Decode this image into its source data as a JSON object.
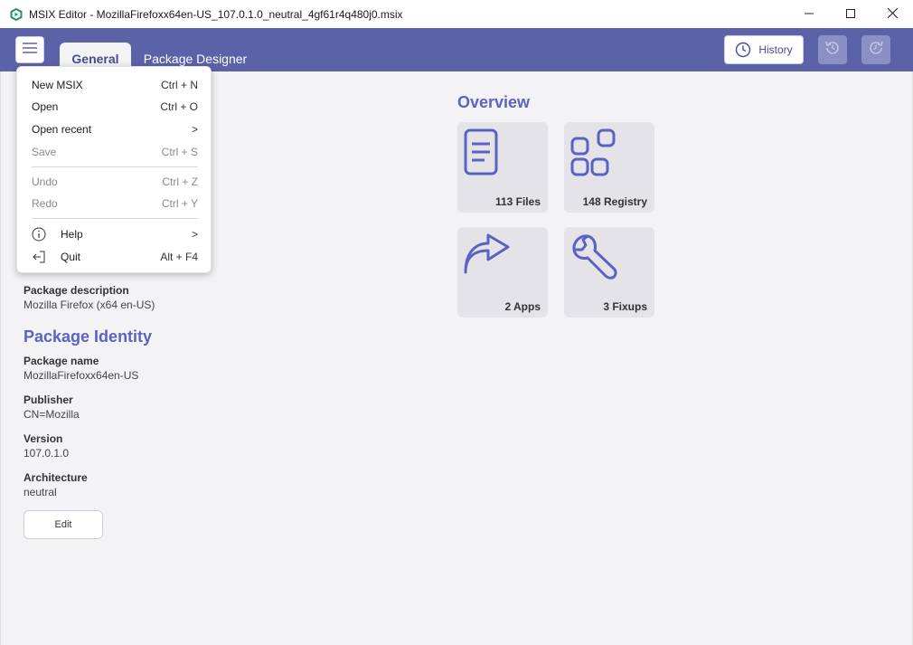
{
  "window": {
    "title": "MSIX Editor - MozillaFirefoxx64en-US_107.0.1.0_neutral_4gf61r4q480j0.msix",
    "controls": [
      "minimize-icon",
      "maximize-icon",
      "close-icon"
    ]
  },
  "header": {
    "tabs": [
      {
        "label": "General",
        "active": true
      },
      {
        "label": "Package Designer",
        "active": false
      }
    ],
    "history_label": "History"
  },
  "menu": {
    "items": [
      {
        "label": "New MSIX",
        "shortcut": "Ctrl + N",
        "enabled": true
      },
      {
        "label": "Open",
        "shortcut": "Ctrl + O",
        "enabled": true
      },
      {
        "label": "Open recent",
        "submenu": ">",
        "enabled": true
      },
      {
        "label": "Save",
        "shortcut": "Ctrl + S",
        "enabled": false
      },
      {
        "label": "Undo",
        "shortcut": "Ctrl + Z",
        "enabled": false
      },
      {
        "label": "Redo",
        "shortcut": "Ctrl + Y",
        "enabled": false
      },
      {
        "label": "Help",
        "submenu": ">",
        "icon": "info-icon",
        "enabled": true
      },
      {
        "label": "Quit",
        "shortcut": "Alt + F4",
        "icon": "exit-icon",
        "enabled": true
      }
    ]
  },
  "package": {
    "description_label": "Package description",
    "description_value": "Mozilla Firefox (x64 en-US)",
    "identity_title": "Package Identity",
    "name_label": "Package name",
    "name_value": "MozillaFirefoxx64en-US",
    "publisher_label": "Publisher",
    "publisher_value": "CN=Mozilla",
    "version_label": "Version",
    "version_value": "107.0.1.0",
    "architecture_label": "Architecture",
    "architecture_value": "neutral",
    "edit_label": "Edit"
  },
  "overview": {
    "title": "Overview",
    "tiles": [
      {
        "label": "113 Files",
        "icon": "document-icon"
      },
      {
        "label": "148 Registry",
        "icon": "apps-grid-icon"
      },
      {
        "label": "2 Apps",
        "icon": "share-arrow-icon"
      },
      {
        "label": "3 Fixups",
        "icon": "wrench-icon"
      }
    ]
  },
  "colors": {
    "accent": "#5b62a8",
    "heading": "#5b62c4",
    "tile_icon": "#5b62c4"
  }
}
